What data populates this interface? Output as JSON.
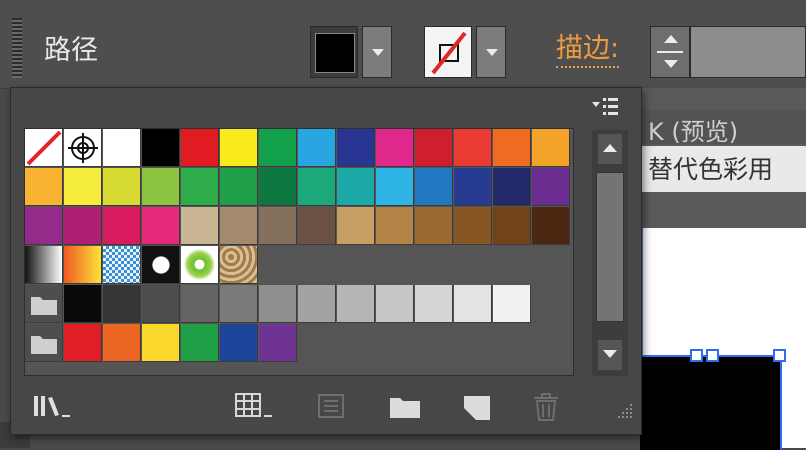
{
  "control_bar": {
    "object_type": "路径",
    "stroke_label": "描边:",
    "fill_color": "#000000",
    "stroke_color": "none"
  },
  "background_document": {
    "tab_text": "K (预览)",
    "recolor_button_text": "替代色彩用"
  },
  "swatches_panel": {
    "panel_menu_icon": "panel-menu-icon",
    "rows": [
      [
        "none",
        "registration",
        "#ffffff",
        "#000000",
        "#e21b23",
        "#fbea1c",
        "#12a04a",
        "#27a6e1",
        "#283592",
        "#e0288c",
        "#cf1f2e",
        "#e93a33",
        "#ef6b21",
        "#f4a32a"
      ],
      [
        "#f8b333",
        "#f5ec3d",
        "#d7db32",
        "#8bc43f",
        "#2eac4a",
        "#1e9f48",
        "#0d7740",
        "#1ba97c",
        "#1ba8a6",
        "#2fb4e6",
        "#2178c1",
        "#283b92",
        "#232a6b",
        "#6a2c8e"
      ],
      [
        "#962a8b",
        "#ad2072",
        "#d81c5f",
        "#e7297d",
        "#cab595",
        "#a4896f",
        "#84705d",
        "#6b5245",
        "#c79f63",
        "#b38446",
        "#9b6a33",
        "#875623",
        "#744219",
        "#4c2712"
      ],
      [
        "gradient-black-white",
        "gradient-orange-yellow",
        "pattern-blue-checker",
        "pattern-dots-black",
        "pattern-green-foliage",
        "pattern-brown-texture"
      ],
      [
        "folder",
        "#0a0a0a",
        "#353535",
        "#4c4c4c",
        "#646464",
        "#7a7a7a",
        "#8f8f8f",
        "#a3a3a3",
        "#b6b6b6",
        "#c7c7c7",
        "#d6d6d6",
        "#e3e3e3",
        "#f1f1f1"
      ],
      [
        "folder",
        "#e01e25",
        "#ea6622",
        "#fbd82c",
        "#1fa047",
        "#1f459b",
        "#6f3393"
      ]
    ],
    "footer_icons": [
      "swatch-library-menu-icon",
      "show-swatch-kinds-icon",
      "swatch-options-icon",
      "new-color-group-icon",
      "new-swatch-icon",
      "delete-swatch-icon"
    ]
  }
}
